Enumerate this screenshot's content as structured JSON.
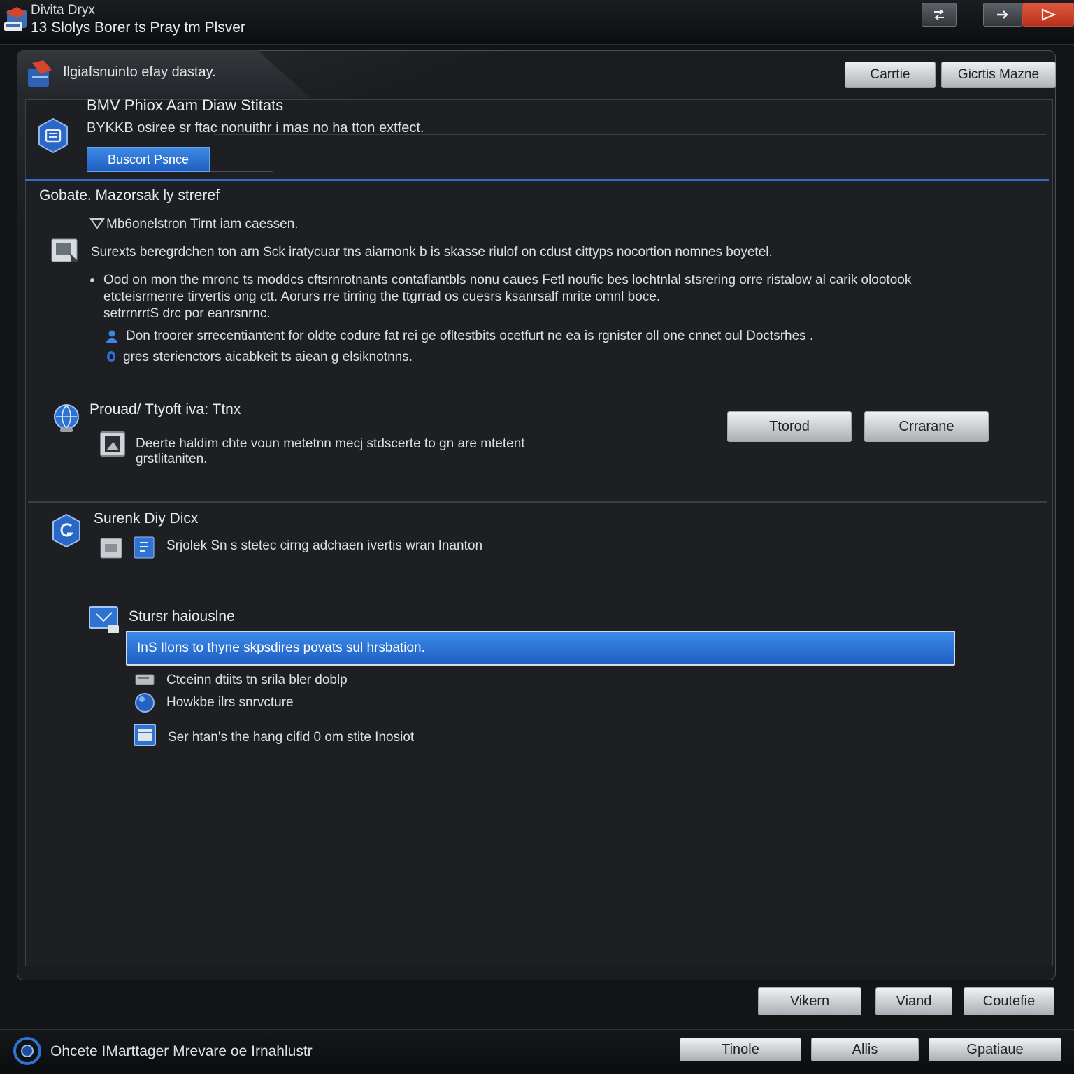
{
  "titlebar": {
    "app_name": "Divita Dryx",
    "title": "13 Slolys Borer ts Pray tm Plsver"
  },
  "tab": {
    "label": "Ilgiafsnuinto efay dastay."
  },
  "top_buttons": {
    "first": "Carrtie",
    "second": "Gicrtis Mazne"
  },
  "header": {
    "title": "BMV Phiox Aam Diaw Stitats",
    "description": "BYKKB osiree sr ftac nonuithr i mas no ha tton extfect.",
    "button": "Buscort Psnce"
  },
  "section1": {
    "title": "Gobate. Mazorsak ly streref",
    "subheading": "Mb6onelstron Tirnt iam caessen.",
    "line1": "Surexts beregrdchen ton arn Sck iratycuar tns aiarnonk b is skasse riulof on cdust cittyps nocortion nomnes boyetel.",
    "line2": "Ood on mon the mronc ts moddcs cftsrnrotnants contaflantbls nonu caues Fetl noufic bes lochtnlal stsrering orre ristalow al carik olootook",
    "line3": "etcteisrmenre tirvertis ong ctt. Aorurs rre tirring the ttgrrad os cuesrs ksanrsalf mrite omnl boce.",
    "line4": "setrrnrrtS drc por eanrsnrnc.",
    "bullet1": "Don troorer srrecentiantent for oldte codure fat rei ge ofltestbits ocetfurt ne ea is rgnister oll one cnnet oul Doctsrhes .",
    "bullet2": "gres sterienctors aicabkeit ts aiean g elsiknotnns."
  },
  "section2": {
    "title": "Prouad/ Ttyoft iva: Ttnx",
    "desc1": "Deerte haldim chte voun metetnn mecj stdscerte to gn are mtetent",
    "desc2": "grstlitaniten.",
    "button1": "Ttorod",
    "button2": "Crrarane"
  },
  "section3": {
    "title": "Surenk Diy Dicx",
    "item": "Srjolek Sn s stetec cirng adchaen ivertis wran Inanton"
  },
  "section4": {
    "title": "Stursr haiouslne",
    "selected": "InS Ilons to thyne skpsdires povats sul hrsbation.",
    "option1": "Ctceinn dtiits tn srila bler doblp",
    "option2": "Howkbe ilrs snrvcture",
    "option3": "Ser htan's the hang cifid 0 om stite Inosiot"
  },
  "bottom_buttons": {
    "b1": "Vikern",
    "b2": "Viand",
    "b3": "Coutefie"
  },
  "status": {
    "text": "Ohcete IMarttager Mrevare oe Irnahlustr"
  },
  "status_buttons": {
    "b1": "Tinole",
    "b2": "Allis",
    "b3": "Gpatiaue"
  },
  "colors": {
    "accent": "#2f6fc8",
    "close": "#d9452c",
    "background": "#1d1f22"
  }
}
